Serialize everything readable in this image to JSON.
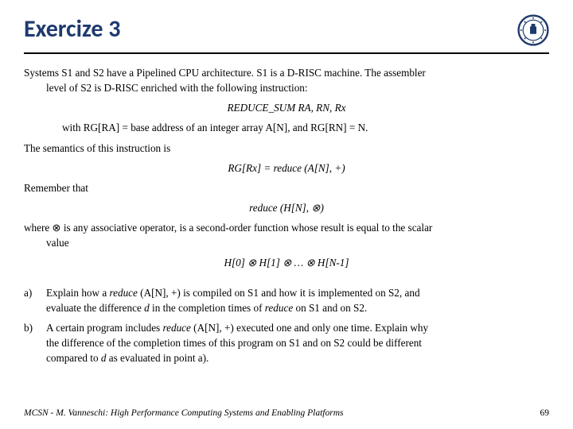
{
  "header": {
    "title": "Exercize 3"
  },
  "body": {
    "p1a": "Systems S1 and S2 have a Pipelined CPU architecture. S1 is a D-RISC machine. The assembler",
    "p1b": "level of S2 is D-RISC enriched with the following instruction:",
    "instr": "REDUCE_SUM   RA, RN, Rx",
    "p2": "with RG[RA] = base address of an integer array A[N], and RG[RN] = N.",
    "p3": "The semantics of this instruction is",
    "sem": "RG[Rx] = reduce (A[N], +)",
    "p4": "Remember that",
    "red": "reduce (H[N], ⊗)",
    "p5a": "where ⊗ is any associative operator, is a second-order function whose result is equal to the scalar",
    "p5b": "value",
    "chain": "H[0] ⊗ H[1] ⊗ … ⊗ H[N-1]"
  },
  "questions": {
    "a_label": "a)",
    "a_line1": "Explain how a ",
    "a_italic": "reduce ",
    "a_line1b": "(A[N], +) is compiled on S1 and how it is implemented on S2, and",
    "a_line2_pre": "evaluate the difference ",
    "a_line2_d": "d",
    "a_line2_mid": " in the completion times of ",
    "a_line2_reduce": "reduce",
    "a_line2_post": " on S1 and on S2.",
    "b_label": "b)",
    "b_line1a": "A certain program includes ",
    "b_italic": "reduce",
    "b_line1b": " (A[N], +) executed one and only one time. Explain why",
    "b_line2": "the difference of the completion times of this program on S1 and on S2 could be different",
    "b_line3_pre": "compared to ",
    "b_line3_d": "d",
    "b_line3_post": " as evaluated in point a)."
  },
  "footer": {
    "left": "MCSN  -   M. Vanneschi: High Performance Computing Systems and Enabling Platforms",
    "page": "69"
  }
}
